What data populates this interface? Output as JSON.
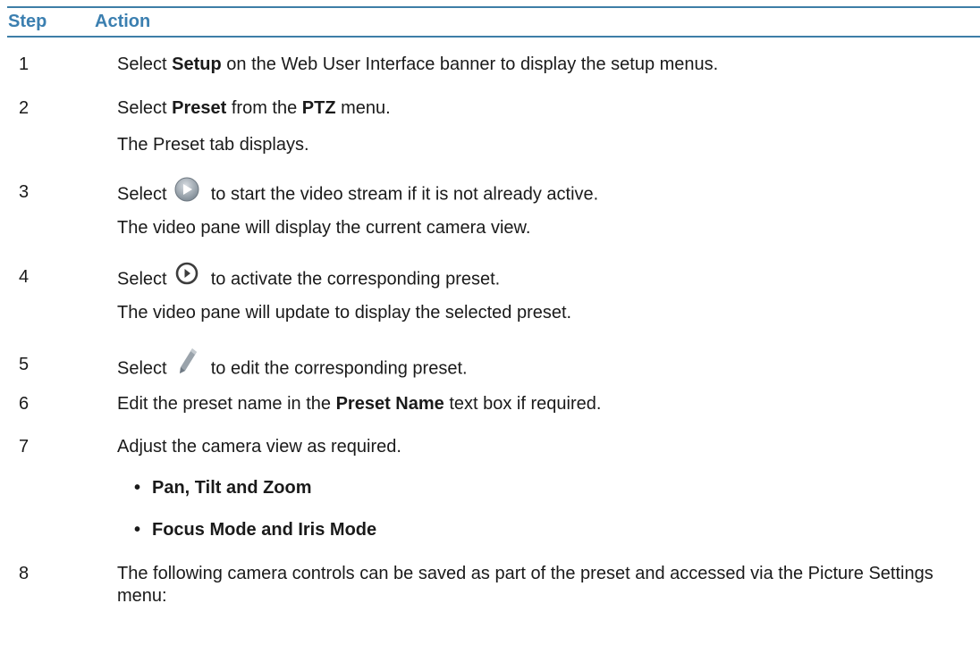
{
  "table": {
    "header_step": "Step",
    "header_action": "Action"
  },
  "steps": [
    {
      "num": "1",
      "pre": "Select ",
      "bold": "Setup",
      "post": " on the Web User Interface banner to display the setup menus."
    },
    {
      "num": "2",
      "pre": "Select ",
      "bold": "Preset",
      "mid": " from the ",
      "bold2": "PTZ",
      "post": " menu.",
      "result": "The Preset tab displays."
    },
    {
      "num": "3",
      "pre": "Select ",
      "icon": "play-button-icon",
      "post": " to start the video stream if it is not already active.",
      "result": "The video pane will display the current camera view."
    },
    {
      "num": "4",
      "pre": "Select ",
      "icon": "activate-preset-icon",
      "post": " to activate the corresponding preset.",
      "result": "The video pane will update to display the selected preset."
    },
    {
      "num": "5",
      "pre": "Select ",
      "icon": "pencil-edit-icon",
      "post": " to edit the corresponding preset."
    },
    {
      "num": "6",
      "pre": "Edit the preset name in the ",
      "bold": "Preset Name",
      "post": " text box if required."
    },
    {
      "num": "7",
      "text": "Adjust the camera view as required.",
      "bullets": [
        "Pan, Tilt and Zoom",
        "Focus Mode and Iris Mode"
      ]
    },
    {
      "num": "8",
      "text": "The following camera controls can be saved as part of the preset and accessed via the Picture Settings menu:"
    }
  ],
  "colors": {
    "accent": "#3b7fb0",
    "rule": "#3e7ea7",
    "text": "#1a1a1a",
    "icon_grey": "#8f9aa4"
  }
}
